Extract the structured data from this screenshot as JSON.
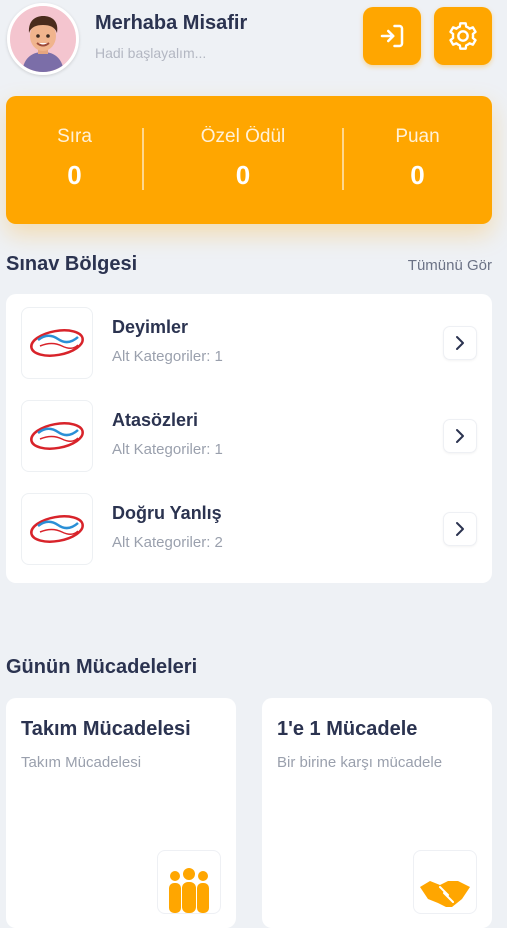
{
  "header": {
    "greeting": "Merhaba Misafir",
    "subtitle": "Hadi başlayalım...",
    "avatar_icon": "user-avatar",
    "login_icon": "login-icon",
    "settings_icon": "gear-icon"
  },
  "stats": [
    {
      "label": "Sıra",
      "value": "0"
    },
    {
      "label": "Özel Ödül",
      "value": "0"
    },
    {
      "label": "Puan",
      "value": "0"
    }
  ],
  "exam_section": {
    "title": "Sınav Bölgesi",
    "see_all": "Tümünü Gör",
    "items": [
      {
        "title": "Deyimler",
        "subtitle": "Alt Kategoriler: 1"
      },
      {
        "title": "Atasözleri",
        "subtitle": "Alt Kategoriler: 1"
      },
      {
        "title": "Doğru Yanlış",
        "subtitle": "Alt Kategoriler: 2"
      }
    ]
  },
  "challenges": {
    "title": "Günün Mücadeleleri",
    "cards": [
      {
        "title": "Takım Mücadelesi",
        "subtitle": "Takım Mücadelesi",
        "icon": "team-icon"
      },
      {
        "title": "1'e 1 Mücadele",
        "subtitle": "Bir birine karşı mücadele",
        "icon": "handshake-icon"
      }
    ]
  },
  "colors": {
    "accent": "#ffa600",
    "background": "#eef1f5",
    "text": "#2b3350"
  }
}
